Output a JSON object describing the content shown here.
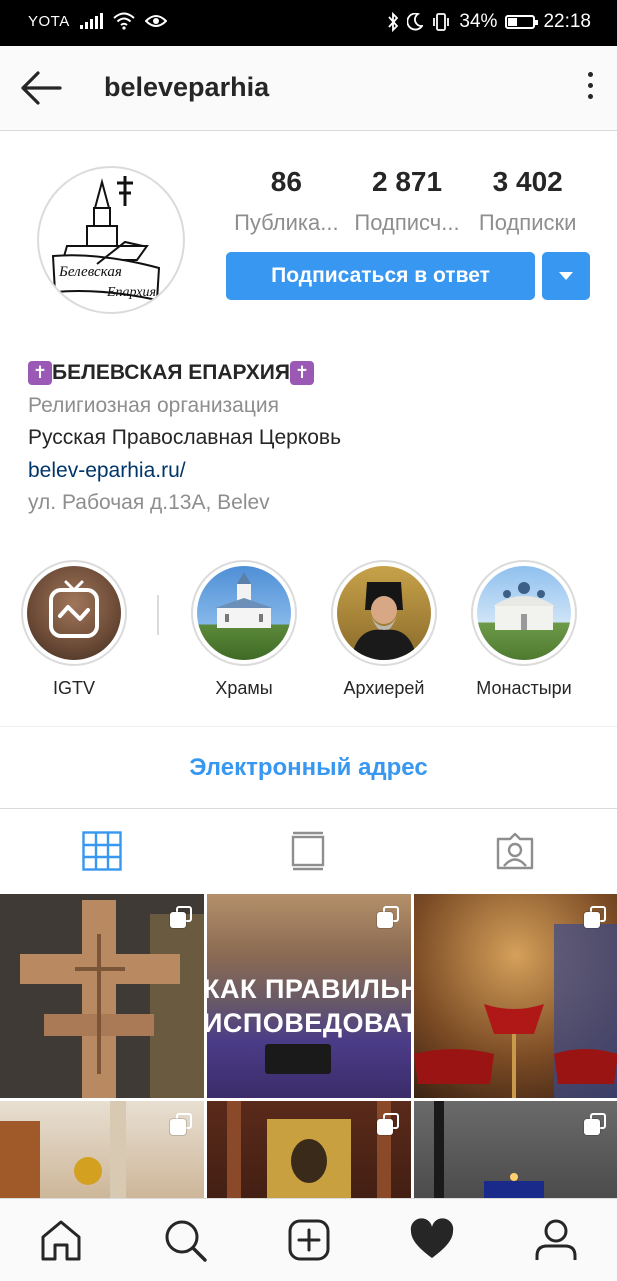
{
  "status_bar": {
    "carrier": "YOTA",
    "battery": "34%",
    "time": "22:18"
  },
  "header": {
    "username": "beleveparhia"
  },
  "profile": {
    "avatar_text_line1": "Белевская",
    "avatar_text_line2": "Епархия",
    "stats": [
      {
        "value": "86",
        "label": "Публика..."
      },
      {
        "value": "2 871",
        "label": "Подписч..."
      },
      {
        "value": "3 402",
        "label": "Подписки"
      }
    ],
    "follow_back_label": "Подписаться в ответ"
  },
  "bio": {
    "cross_icon": "✝",
    "name": "БЕЛЕВСКАЯ ЕПАРХИЯ",
    "category": "Религиозная организация",
    "description": "Русская Православная Церковь",
    "website": "belev-eparhia.ru/",
    "address": "ул. Рабочая д.13А, Belev"
  },
  "highlights": [
    {
      "label": "IGTV"
    },
    {
      "label": "Храмы"
    },
    {
      "label": "Архиерей"
    },
    {
      "label": "Монастыри"
    }
  ],
  "email_label": "Электронный адрес",
  "posts": {
    "overlay_line1": "КАК ПРАВИЛЬНО",
    "overlay_line2": "ИСПОВЕДОВАТЬСЯ"
  },
  "colors": {
    "accent": "#3897f0",
    "link": "#003569",
    "muted": "#8e8e8e"
  }
}
